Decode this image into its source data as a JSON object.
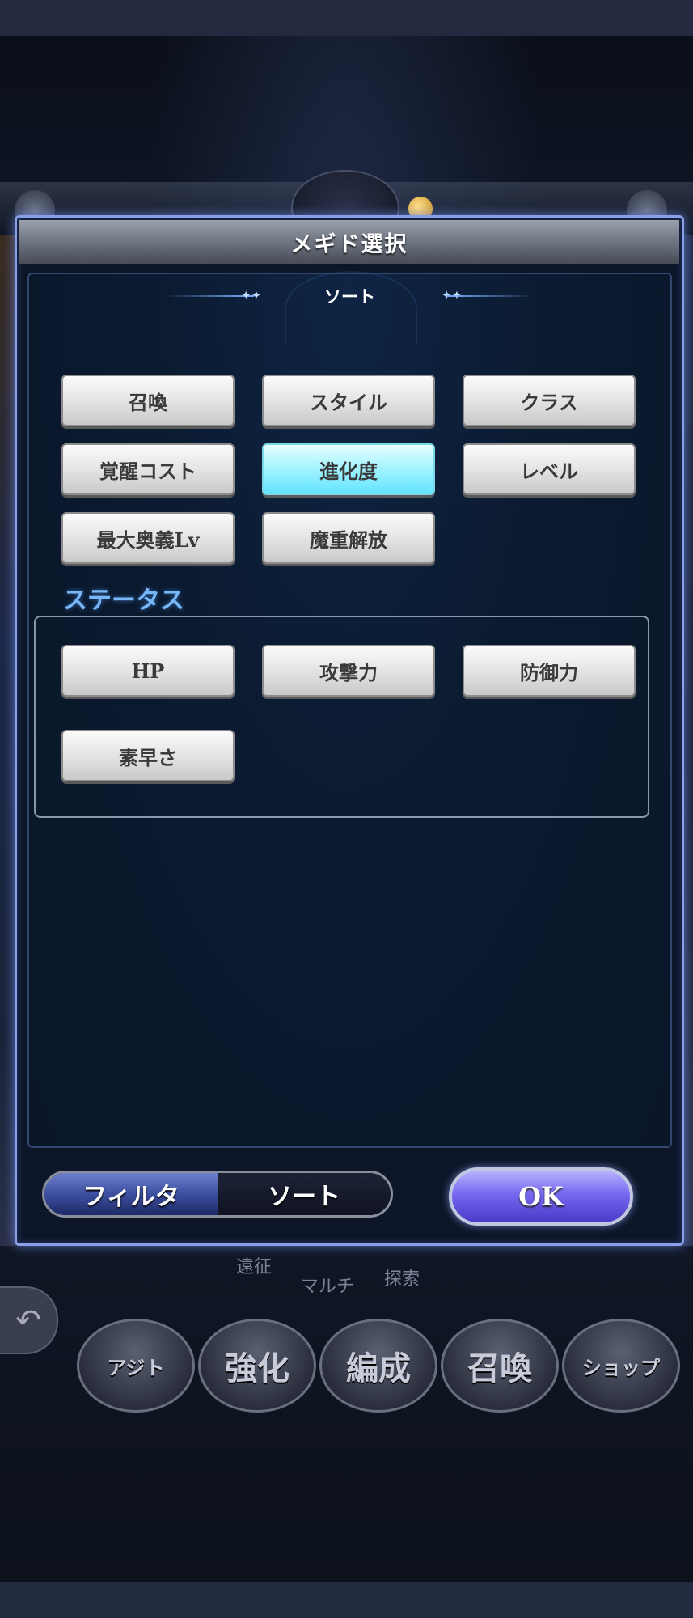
{
  "dialog": {
    "title": "メギド選択",
    "sort_title": "ソート"
  },
  "sort_buttons": [
    {
      "label": "召喚",
      "active": false
    },
    {
      "label": "スタイル",
      "active": false
    },
    {
      "label": "クラス",
      "active": false
    },
    {
      "label": "覚醒コスト",
      "active": false
    },
    {
      "label": "進化度",
      "active": true
    },
    {
      "label": "レベル",
      "active": false
    },
    {
      "label": "最大奥義Lv",
      "active": false
    },
    {
      "label": "魔重解放",
      "active": false
    }
  ],
  "status": {
    "label": "ステータス",
    "buttons": [
      {
        "label": "HP"
      },
      {
        "label": "攻撃力"
      },
      {
        "label": "防御力"
      },
      {
        "label": "素早さ"
      }
    ]
  },
  "footer": {
    "filter_label": "フィルタ",
    "sort_label": "ソート",
    "ok_label": "OK"
  },
  "background": {
    "submenu": [
      "遠征",
      "マルチ",
      "探索"
    ],
    "nav": [
      {
        "label": "アジト"
      },
      {
        "label": "強化"
      },
      {
        "label": "編成"
      },
      {
        "label": "召喚"
      },
      {
        "label": "ショップ"
      }
    ]
  },
  "colors": {
    "active_button": "#62e4ff",
    "dialog_border": "#8aa0e6",
    "status_label": "#79b8f8",
    "ok_button": "#7668f0"
  }
}
